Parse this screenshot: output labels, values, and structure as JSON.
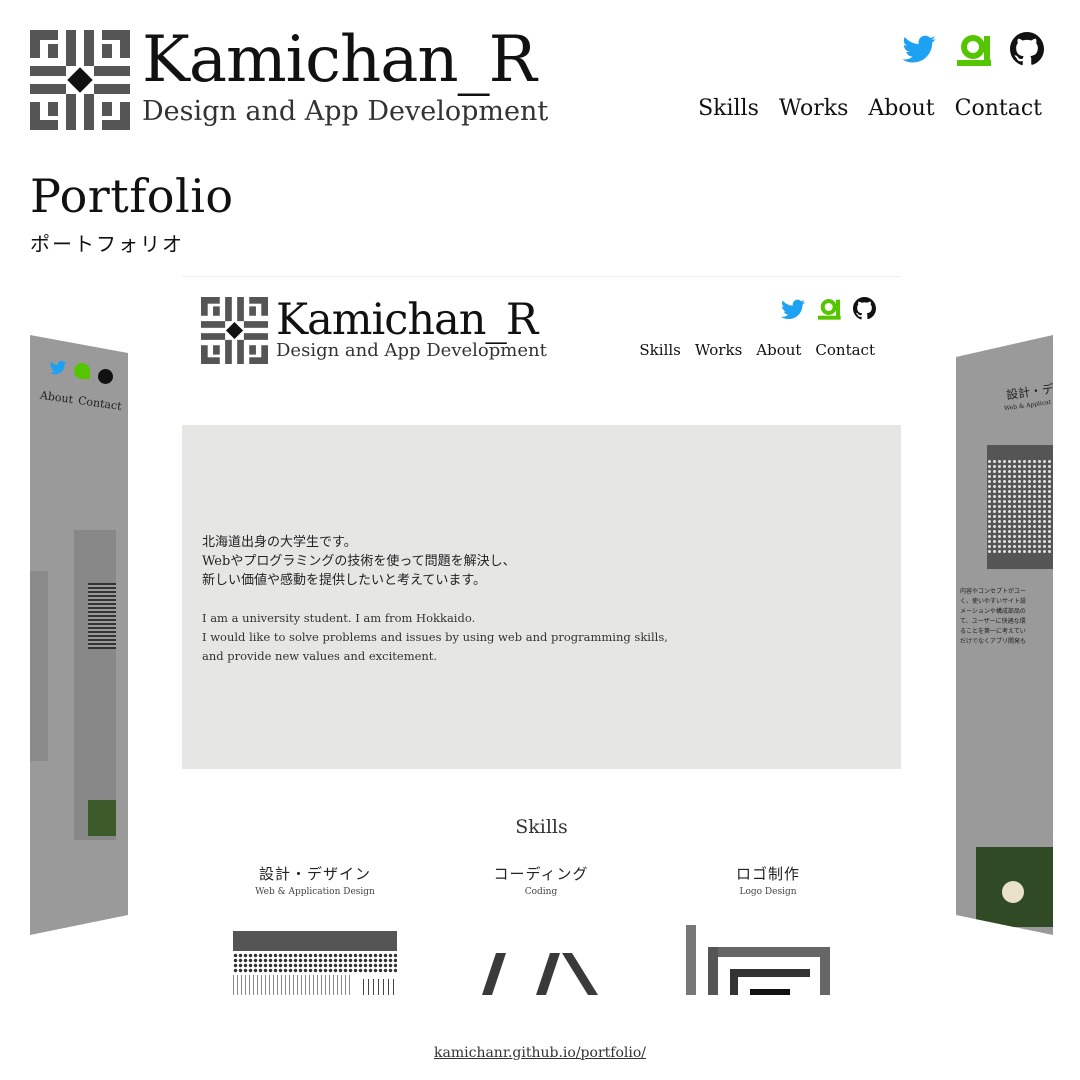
{
  "header": {
    "title": "Kamichan_R",
    "subtitle": "Design and App Development",
    "social": [
      "twitter-icon",
      "qiita-icon",
      "github-icon"
    ],
    "nav": [
      "Skills",
      "Works",
      "About",
      "Contact"
    ]
  },
  "page": {
    "title": "Portfolio",
    "subtitle": "ポートフォリオ"
  },
  "preview": {
    "title": "Kamichan_R",
    "subtitle": "Design and App Development",
    "nav": [
      "Skills",
      "Works",
      "About",
      "Contact"
    ],
    "hero_jp": [
      "北海道出身の大学生です。",
      "Webやプログラミングの技術を使って問題を解決し、",
      "新しい価値や感動を提供したいと考えています。"
    ],
    "hero_en": [
      "I am a university student. I am from Hokkaido.",
      "I would like to solve problems and issues by using web and programming skills,",
      "and provide new values and excitement."
    ],
    "skills_heading": "Skills",
    "skills": [
      {
        "jp": "設計・デザイン",
        "en": "Web & Application Design"
      },
      {
        "jp": "コーディング",
        "en": "Coding"
      },
      {
        "jp": "ロゴ制作",
        "en": "Logo Design"
      }
    ]
  },
  "side_left": {
    "nav_fragment": [
      "About",
      "Contact"
    ]
  },
  "side_right": {
    "heading": "設計・デ",
    "subheading": "Web & Applicat",
    "body": [
      "内容やコンセプトがユー",
      "く、使いやすいサイト設",
      "メーションや構成部品の",
      "て、ユーザーに快適な環",
      "ることを第一に考えてい",
      "だけでなくアプリ開発も"
    ]
  },
  "footer": {
    "url": "kamichanr.github.io/portfolio/"
  },
  "colors": {
    "twitter": "#1da1f2",
    "qiita": "#55c500",
    "github": "#111111",
    "logo_gray": "#555555",
    "hero_bg": "#e6e6e5",
    "side_panel": "#9a9a9a"
  }
}
